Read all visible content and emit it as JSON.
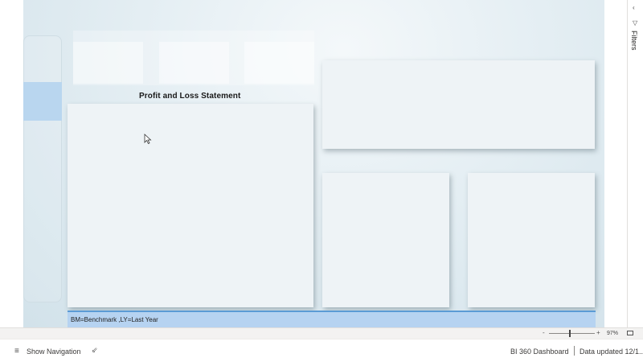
{
  "report": {
    "visual_title": "Profit and Loss Statement",
    "footnote": "BM=Benchmark ,LY=Last Year"
  },
  "filters_pane": {
    "label": "Filters",
    "chevron_icon": "chevron-left-icon",
    "funnel_icon": "filter-funnel-icon"
  },
  "zoom": {
    "minus": "-",
    "plus": "+",
    "level": "97%",
    "level_fraction": 0.97
  },
  "status_bar": {
    "show_navigation": "Show Navigation",
    "dashboard_name": "BI 360 Dashboard",
    "data_updated": "Data updated 12/1..."
  },
  "colors": {
    "footnote_bar": "#b6d3f1",
    "footnote_border": "#5b9bd5",
    "nav_active": "#b9d6ef"
  }
}
